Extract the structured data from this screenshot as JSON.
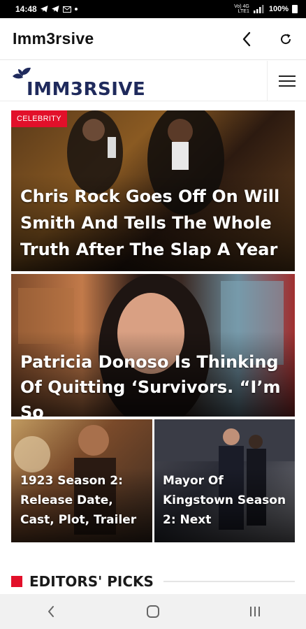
{
  "status_bar": {
    "time": "14:48",
    "network_label_top": "Vo) 4G",
    "network_label_bottom": "LTE1",
    "battery": "100%"
  },
  "app_bar": {
    "title": "Imm3rsive",
    "back_icon": "chevron-left-icon",
    "refresh_icon": "refresh-icon"
  },
  "site": {
    "logo_text": "IMM3RSIVE",
    "brand_color": "#1f2a5c",
    "accent_color": "#e2102a",
    "menu_icon": "hamburger-menu-icon"
  },
  "articles": [
    {
      "tag": "CELEBRITY",
      "title": "Chris Rock Goes Off On Will Smith And Tells The Whole Truth After The Slap A Year"
    },
    {
      "title": "Patricia Donoso Is Thinking Of Quitting ‘Survivors. “I’m So"
    },
    {
      "title": "1923 Season 2: Release Date, Cast, Plot, Trailer"
    },
    {
      "title": "Mayor Of Kingstown Season 2: Next"
    }
  ],
  "section": {
    "title": "EDITORS' PICKS"
  }
}
